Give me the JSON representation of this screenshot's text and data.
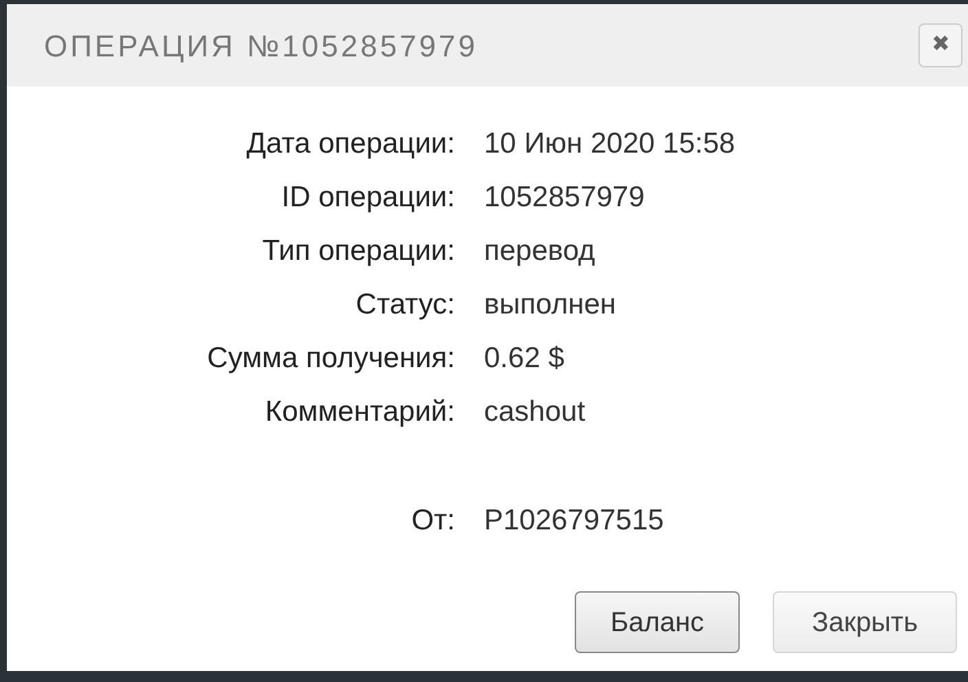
{
  "dialog": {
    "title": "ОПЕРАЦИЯ №1052857979",
    "close": "✖"
  },
  "fields": [
    {
      "label": "Дата операции:",
      "value": "10 Июн 2020 15:58"
    },
    {
      "label": "ID операции:",
      "value": "1052857979"
    },
    {
      "label": "Тип операции:",
      "value": "перевод"
    },
    {
      "label": "Статус:",
      "value": "выполнен"
    },
    {
      "label": "Сумма получения:",
      "value": "0.62 $"
    },
    {
      "label": "Комментарий:",
      "value": "cashout"
    }
  ],
  "sender": {
    "label": "От:",
    "value": "P1026797515"
  },
  "buttons": [
    {
      "label": "Баланс",
      "focused": true
    },
    {
      "label": "Закрыть",
      "focused": false
    }
  ]
}
